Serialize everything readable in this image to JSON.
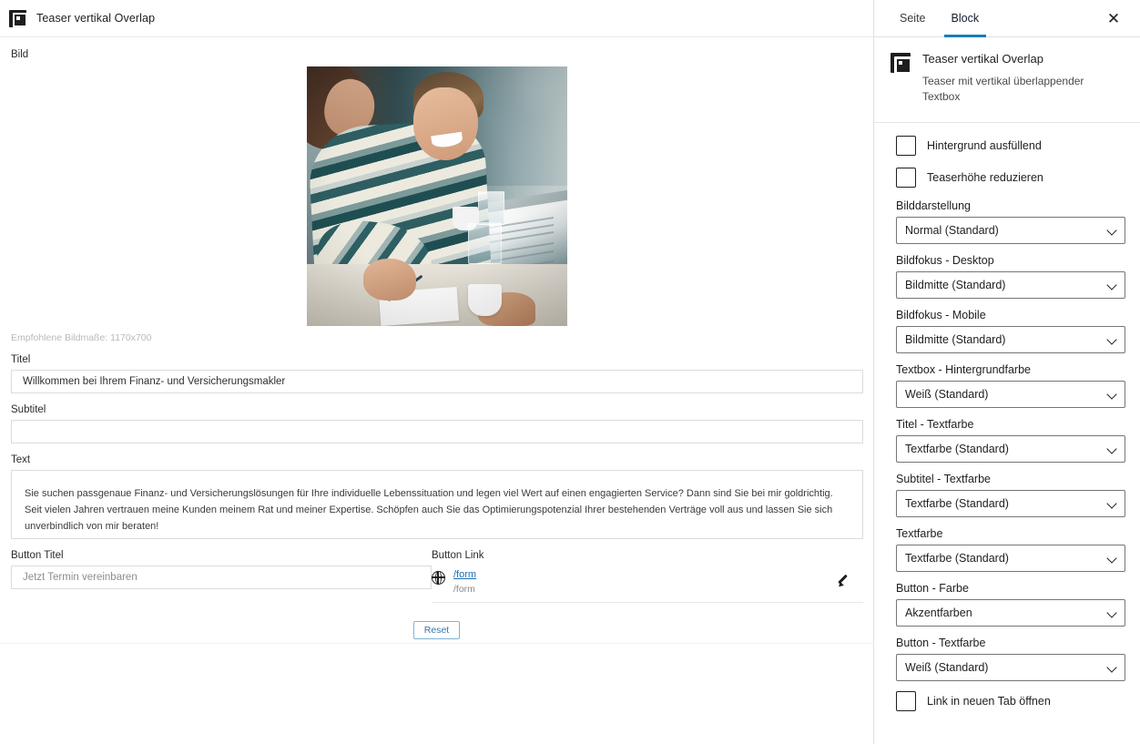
{
  "editor": {
    "block_toolbar": {
      "title": "Teaser vertikal Overlap",
      "icon": "block-teaser-icon"
    },
    "fields": {
      "image_label": "Bild",
      "image_hint": "Empfohlene Bildmaße: 1170x700",
      "title_label": "Titel",
      "title_value": "Willkommen bei Ihrem Finanz- und Versicherungsmakler",
      "subtitle_label": "Subtitel",
      "subtitle_value": "",
      "subtitle_placeholder": "",
      "text_label": "Text",
      "text_value": "Sie suchen passgenaue Finanz- und Versicherungslösungen für Ihre individuelle Lebenssituation und legen viel Wert auf einen engagierten Service? Dann sind Sie bei mir goldrichtig. Seit vielen Jahren vertrauen meine Kunden meinem Rat und meiner Expertise. Schöpfen auch Sie das Optimierungspotenzial Ihrer bestehenden Verträge voll aus und lassen Sie sich unverbindlich von mir beraten!",
      "button_title_label": "Button Titel",
      "button_title_placeholder": "Jetzt Termin vereinbaren",
      "button_title_value": "",
      "button_link_label": "Button Link",
      "button_link_url": "/form",
      "button_link_sub": "/form"
    },
    "reset_label": "Reset"
  },
  "sidebar": {
    "tabs": [
      {
        "label": "Seite",
        "active": false
      },
      {
        "label": "Block",
        "active": true
      }
    ],
    "close_label": "✕",
    "block_card": {
      "title": "Teaser vertikal Overlap",
      "description": "Teaser mit vertikal überlappender Textbox"
    },
    "checkboxes": [
      {
        "label": "Hintergrund ausfüllend",
        "checked": false
      },
      {
        "label": "Teaserhöhe reduzieren",
        "checked": false
      }
    ],
    "selects": [
      {
        "label": "Bilddarstellung",
        "value": "Normal (Standard)"
      },
      {
        "label": "Bildfokus - Desktop",
        "value": "Bildmitte (Standard)"
      },
      {
        "label": "Bildfokus - Mobile",
        "value": "Bildmitte (Standard)"
      },
      {
        "label": "Textbox - Hintergrundfarbe",
        "value": "Weiß (Standard)"
      },
      {
        "label": "Titel - Textfarbe",
        "value": "Textfarbe (Standard)"
      },
      {
        "label": "Subtitel - Textfarbe",
        "value": "Textfarbe (Standard)"
      },
      {
        "label": "Textfarbe",
        "value": "Textfarbe (Standard)"
      },
      {
        "label": "Button - Farbe",
        "value": "Akzentfarben"
      },
      {
        "label": "Button - Textfarbe",
        "value": "Weiß (Standard)"
      }
    ],
    "checkbox_last": {
      "label": "Link in neuen Tab öffnen",
      "checked": false
    }
  },
  "colors": {
    "accent": "#1a7cb8",
    "link": "#1a70b8",
    "reset_border": "#7fb3d5",
    "text": "#1e1e1e"
  }
}
